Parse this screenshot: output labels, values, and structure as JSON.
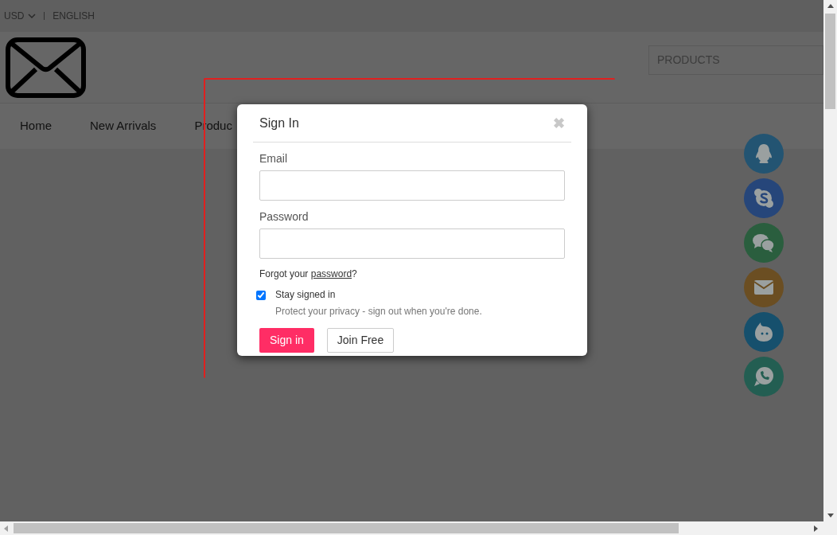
{
  "top_bar": {
    "currency": "USD",
    "language": "ENGLISH"
  },
  "header": {
    "search": {
      "placeholder": "PRODUCTS"
    }
  },
  "nav": {
    "items": [
      "Home",
      "New Arrivals",
      "Produc"
    ]
  },
  "float_contacts": [
    {
      "kind": "qq",
      "color": "#235472"
    },
    {
      "kind": "skype",
      "color": "#26467a"
    },
    {
      "kind": "wechat",
      "color": "#2a5e3e"
    },
    {
      "kind": "mail",
      "color": "#6b4e22"
    },
    {
      "kind": "chat",
      "color": "#16506d"
    },
    {
      "kind": "whatsapp",
      "color": "#235e52"
    }
  ],
  "modal": {
    "title": "Sign In",
    "close": "✖",
    "email_label": "Email",
    "password_label": "Password",
    "forgot_prefix": "Forgot your ",
    "forgot_link": "password",
    "forgot_suffix": "?",
    "stay_signed_in": {
      "label": "Stay signed in",
      "checked": true
    },
    "privacy_note": "Protect your privacy - sign out when you're done.",
    "buttons": [
      "Sign in",
      "Join Free"
    ]
  }
}
